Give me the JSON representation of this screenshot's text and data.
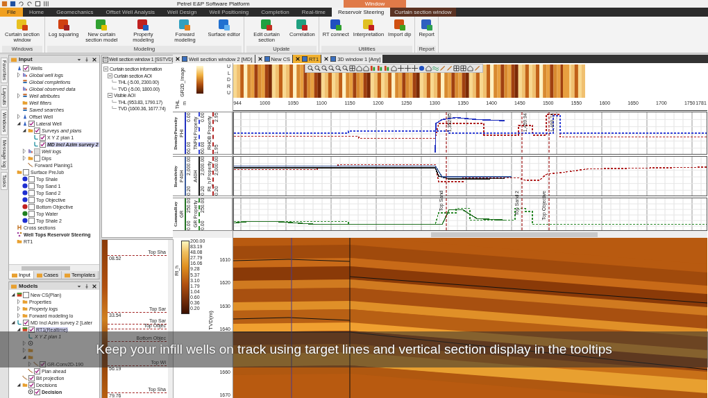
{
  "title_bar": {
    "title": "Petrel E&P Software Platform",
    "context_label": "Window"
  },
  "ribbon_tabs": [
    {
      "label": "File",
      "selected": false,
      "kind": "file"
    },
    {
      "label": "Home",
      "selected": false,
      "kind": "normal"
    },
    {
      "label": "Geomechanics",
      "selected": false,
      "kind": "normal"
    },
    {
      "label": "Offset Well Analysis",
      "selected": false,
      "kind": "normal"
    },
    {
      "label": "Well Design",
      "selected": false,
      "kind": "normal"
    },
    {
      "label": "Well Positioning",
      "selected": false,
      "kind": "normal"
    },
    {
      "label": "Completion",
      "selected": false,
      "kind": "normal"
    },
    {
      "label": "Real-time",
      "selected": false,
      "kind": "normal"
    },
    {
      "label": "Reservoir Steering",
      "selected": true,
      "kind": "normal"
    },
    {
      "label": "Curtain section window",
      "selected": false,
      "kind": "context"
    }
  ],
  "ribbon_groups": [
    {
      "title": "Windows",
      "buttons": [
        "Curtain section window"
      ]
    },
    {
      "title": "Modeling",
      "buttons": [
        "Log squaring",
        "New curtain section model",
        "Property modeling",
        "Forward modeling",
        "Surface editor"
      ]
    },
    {
      "title": "Update",
      "buttons": [
        "Edit curtain section",
        "Correlation"
      ]
    },
    {
      "title": "Utilities",
      "buttons": [
        "RT connect",
        "Interpretation",
        "Import dip"
      ]
    },
    {
      "title": "Report",
      "buttons": [
        "Report"
      ]
    }
  ],
  "side_tabs": [
    "Favorites",
    "Layouts",
    "Windows",
    "Message log",
    "Tasks"
  ],
  "input_panel": {
    "title": "Input",
    "tree": [
      {
        "label": "Wells",
        "kind": "well",
        "checked": true,
        "italic": false,
        "bold": false,
        "selected": false,
        "children": [
          {
            "label": "Global well logs",
            "kind": "log",
            "expanded": false,
            "italic": true,
            "bold": false,
            "selected": false
          },
          {
            "label": "Global completions",
            "kind": "data",
            "italic": true,
            "bold": false,
            "selected": false
          },
          {
            "label": "Global observed data",
            "kind": "log",
            "italic": true,
            "bold": false,
            "selected": false
          },
          {
            "label": "Well attributes",
            "kind": "data",
            "expanded": false,
            "italic": true,
            "bold": false,
            "selected": false
          },
          {
            "label": "Well filters",
            "kind": "folder",
            "italic": true,
            "bold": false,
            "selected": false
          },
          {
            "label": "Saved searches",
            "kind": "data",
            "italic": true,
            "bold": false,
            "selected": false
          },
          {
            "label": "Offset Well",
            "kind": "well",
            "expanded": false,
            "italic": false,
            "bold": false,
            "selected": false
          },
          {
            "label": "Lateral Well",
            "kind": "well",
            "checked": true,
            "expanded": true,
            "italic": false,
            "bold": false,
            "selected": false,
            "children": [
              {
                "label": "Surveys and plans",
                "kind": "folder",
                "checked": true,
                "expanded": true,
                "italic": true,
                "bold": false,
                "selected": false,
                "children": [
                  {
                    "label": "X Y Z plan 1",
                    "kind": "plan",
                    "checked": true,
                    "italic": false,
                    "bold": false,
                    "selected": false
                  },
                  {
                    "label": "MD Incl Azim survey 2",
                    "kind": "plan",
                    "checked": true,
                    "italic": true,
                    "bold": true,
                    "selected": true
                  }
                ]
              },
              {
                "label": "Well logs",
                "kind": "log",
                "checked": false,
                "disabled": true,
                "expanded": false,
                "italic": true,
                "bold": false,
                "selected": false
              },
              {
                "label": "Dips",
                "kind": "folder",
                "checked": false,
                "disabled": false,
                "expanded": false,
                "italic": false,
                "bold": false,
                "selected": false
              },
              {
                "label": "Forward Planing1",
                "kind": "path",
                "italic": false,
                "bold": false,
                "selected": false
              }
            ]
          }
        ]
      },
      {
        "label": "Surface PreJob",
        "kind": "folder",
        "checked": false,
        "italic": false,
        "bold": false,
        "selected": false,
        "children": [
          {
            "label": "Top Shale",
            "kind": "surface",
            "color": "#1f2fd0",
            "checked": false,
            "italic": false,
            "bold": false,
            "selected": false
          },
          {
            "label": "Top Sand 1",
            "kind": "surface",
            "color": "#1f2fd0",
            "checked": false,
            "italic": false,
            "bold": false,
            "selected": false
          },
          {
            "label": "Top Sand 2",
            "kind": "surface",
            "color": "#1f2fd0",
            "checked": false,
            "italic": false,
            "bold": false,
            "selected": false
          },
          {
            "label": "Top Objective",
            "kind": "surface",
            "color": "#1f2fd0",
            "checked": false,
            "italic": false,
            "bold": false,
            "selected": false
          },
          {
            "label": "Bottom Objective",
            "kind": "surface",
            "color": "#c02020",
            "checked": false,
            "italic": false,
            "bold": false,
            "selected": false
          },
          {
            "label": "Top Water",
            "kind": "surface",
            "color": "#208020",
            "checked": false,
            "italic": false,
            "bold": false,
            "selected": false
          },
          {
            "label": "Top Shale 2",
            "kind": "surface",
            "color": "#1f2fd0",
            "checked": false,
            "italic": false,
            "bold": false,
            "selected": false
          }
        ]
      },
      {
        "label": "Cross sections",
        "kind": "cross",
        "italic": false,
        "bold": false,
        "selected": false
      },
      {
        "label": "Well Tops Reservoir Steering",
        "kind": "tops",
        "italic": false,
        "bold": true,
        "selected": false
      },
      {
        "label": "RT1",
        "kind": "folder",
        "italic": false,
        "bold": false,
        "selected": false
      }
    ],
    "tabs": [
      {
        "label": "Input",
        "selected": true
      },
      {
        "label": "Cases",
        "selected": false
      },
      {
        "label": "Templates",
        "selected": false
      }
    ]
  },
  "models_panel": {
    "title": "Models",
    "tree": [
      {
        "label": "New CS(Plan)",
        "kind": "model",
        "checked": false,
        "expanded": true,
        "italic": false,
        "bold": false,
        "selected": false,
        "children": [
          {
            "label": "Properties",
            "kind": "folder",
            "expanded": false,
            "italic": false,
            "bold": false,
            "selected": false
          },
          {
            "label": "Property logs",
            "kind": "folder",
            "expanded": false,
            "italic": true,
            "bold": false,
            "selected": false
          },
          {
            "label": "Forward modeling lo",
            "kind": "folder",
            "expanded": false,
            "italic": false,
            "bold": false,
            "selected": false
          }
        ]
      },
      {
        "label": "MD Incl Azim survey 2 [Later",
        "kind": "plan",
        "checked": true,
        "expanded": true,
        "italic": false,
        "bold": false,
        "selected": false,
        "children": [
          {
            "label": "RT1(Realtime)",
            "kind": "model",
            "checked": true,
            "expanded": true,
            "italic": false,
            "bold": false,
            "selected": true,
            "children": [
              {
                "label": "X Y Z plan 1",
                "kind": "plan",
                "italic": true,
                "bold": false,
                "selected": false
              },
              {
                "kind": "target",
                "expanded": false
              },
              {
                "kind": "folder",
                "expanded": false
              },
              {
                "kind": "folder",
                "expanded": true,
                "children": [
                  {
                    "label": "GR-Conv2D-190",
                    "kind": "path",
                    "checked": true,
                    "expanded": false,
                    "italic": false,
                    "bold": false,
                    "selected": false
                  }
                ]
              },
              {
                "label": "Plan ahead",
                "kind": "path",
                "checked": true,
                "italic": false,
                "bold": false,
                "selected": false
              }
            ]
          },
          {
            "label": "Bit projection",
            "kind": "path",
            "checked": true,
            "italic": false,
            "bold": false,
            "selected": false
          },
          {
            "label": "Decisions",
            "kind": "folder",
            "checked": true,
            "expanded": true,
            "italic": false,
            "bold": false,
            "selected": false,
            "children": [
              {
                "label": "Decision",
                "kind": "target",
                "checked": true,
                "italic": false,
                "bold": true,
                "selected": false
              }
            ]
          }
        ]
      }
    ]
  },
  "info_window": {
    "tab": "Well section window 1 [SSTVD]",
    "tree": [
      {
        "label": "Curtain section information",
        "children": [
          {
            "label": "Curtain section AOI",
            "children": [
              {
                "label": "THL (-5.00, 2300.00)"
              },
              {
                "label": "TVD (-5.00, 1800.00)"
              }
            ]
          },
          {
            "label": "Visible AOI",
            "children": [
              {
                "label": "THL (953.83, 1790.17)"
              },
              {
                "label": "TVD (1600.36, 1677.74)"
              }
            ]
          }
        ]
      }
    ],
    "tops": [
      {
        "label": "Top Sha",
        "reading": "08.52"
      },
      {
        "label": "Top Sar",
        "reading": "33.54"
      },
      {
        "label": "Top Sar"
      },
      {
        "label": "Top Objec"
      },
      {
        "label": "Bottom Objec"
      },
      {
        "label": "Top Wi",
        "reading": "56.19"
      },
      {
        "label": "Top Sha",
        "reading": "79.76"
      }
    ]
  },
  "section_window": {
    "tabs": [
      {
        "label": "Well section window 2 [MD]",
        "selected": false
      },
      {
        "label": "New CS",
        "selected": false
      },
      {
        "label": "RT1",
        "selected": true
      },
      {
        "label": "3D window 1 [Any]",
        "selected": false
      }
    ],
    "image_label": "GR2D_Image",
    "image_rows": [
      "U",
      "L",
      "D",
      "R",
      "U"
    ],
    "axis_label": "THL",
    "axis_unit": "m",
    "thl_ticks": [
      "944",
      "1000",
      "1050",
      "1100",
      "1150",
      "1200",
      "1250",
      "1300",
      "1350",
      "1400",
      "1450",
      "1500",
      "1550",
      "1600",
      "1650",
      "1700",
      "1750",
      "1781"
    ],
    "tracks": [
      {
        "title": "DensityPorosity",
        "curves": [
          {
            "name": "PHI",
            "min": "60.00",
            "max": "0.00",
            "color": "#2030c0"
          },
          {
            "name": "TNPH Property",
            "min": "60.00",
            "max": "0.00",
            "color": "#3040d8"
          },
          {
            "name": "RHOB Property",
            "min": "1.95",
            "max": "2.95",
            "color": "#b02020"
          }
        ]
      },
      {
        "title": "Resistivity",
        "curves": [
          {
            "name": "P40H",
            "min": "0.20",
            "max": "2,000.00",
            "color": "#3a5a9a"
          },
          {
            "name": "A40H",
            "min": "0.20",
            "max": "2,000.00",
            "color": "#111111"
          },
          {
            "name": "Rt_h Property",
            "min": "0.20",
            "max": "2,000.00",
            "color": "#b02020"
          }
        ]
      },
      {
        "title": "GammaRay",
        "curves": [
          {
            "name": "GR",
            "min": "0.00",
            "max": "250.00",
            "color": "#207020"
          },
          {
            "name": "GR Property",
            "min": "0.00",
            "max": "250.00",
            "color": "#2a8a2a"
          }
        ]
      }
    ],
    "well_tops": [
      {
        "label": "Top Sand",
        "md": "1,352.85"
      },
      {
        "label": "Top Sand 2",
        "md": "1,459.94"
      },
      {
        "label": "Top Objective",
        "md": "1,499.74"
      }
    ],
    "colorbar": {
      "label": "Rt_h",
      "values": [
        "200.00",
        "83.19",
        "48.08",
        "27.79",
        "16.06",
        "9.28",
        "5.37",
        "3.10",
        "1.79",
        "1.04",
        "0.60",
        "0.36",
        "0.20"
      ]
    },
    "tvd_label": "TVD(m)",
    "tvd_ticks_upper": [
      "1610",
      "1620",
      "1630",
      "1640"
    ],
    "tvd_ticks_lower": [
      "1660",
      "1670"
    ]
  },
  "caption": "Keep your infill wells on track using target lines and vertical section display in the tooltips"
}
